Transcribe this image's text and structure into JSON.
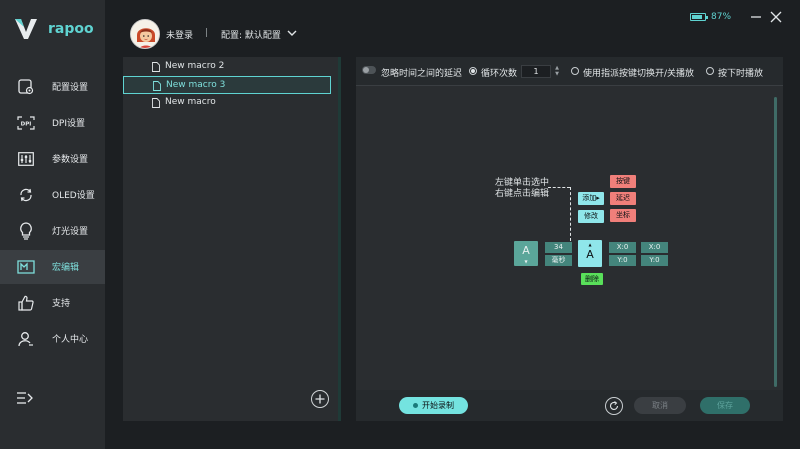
{
  "brand": {
    "logo_text": "rapoo",
    "accent": "#5fd3d1"
  },
  "sidebar": {
    "items": [
      {
        "label": "配置设置",
        "icon": "config-settings-icon"
      },
      {
        "label": "DPI设置",
        "icon": "dpi-icon"
      },
      {
        "label": "参数设置",
        "icon": "parameter-sliders-icon"
      },
      {
        "label": "OLED设置",
        "icon": "oled-refresh-icon"
      },
      {
        "label": "灯光设置",
        "icon": "light-bulb-icon"
      },
      {
        "label": "宏编辑",
        "icon": "macro-edit-icon",
        "active": true
      },
      {
        "label": "支持",
        "icon": "thumbs-up-icon"
      },
      {
        "label": "个人中心",
        "icon": "user-icon"
      }
    ],
    "collapse_icon": "collapse-menu-icon"
  },
  "header": {
    "login_status": "未登录",
    "separator": "|",
    "config_label": "配置: 默认配置",
    "battery_percent": "87%",
    "battery_level": 0.87
  },
  "macro_list": {
    "items": [
      {
        "name": "New macro 2",
        "selected": false
      },
      {
        "name": "New macro 3",
        "selected": true
      },
      {
        "name": "New macro",
        "selected": false
      }
    ]
  },
  "options": {
    "ignore_delay": "忽略时间之间的延迟",
    "loop_count_label": "循环次数",
    "loop_count_value": "1",
    "toggle_label": "使用指派按键切换开/关播放",
    "hold_label": "按下时播放"
  },
  "illustration": {
    "hint_line1": "左键单击选中",
    "hint_line2": "右键点击编辑",
    "add": "添加▸",
    "edit": "修改",
    "key": "按键",
    "delay": "延迟",
    "coord": "坐标",
    "key_char": "A",
    "delay_value": "34",
    "delay_unit": "毫秒",
    "delete": "删除",
    "x1": "X:0",
    "y1": "Y:0",
    "x2": "X:0",
    "y2": "Y:0"
  },
  "footer": {
    "record": "开始录制",
    "cancel": "取消",
    "save": "保存"
  }
}
